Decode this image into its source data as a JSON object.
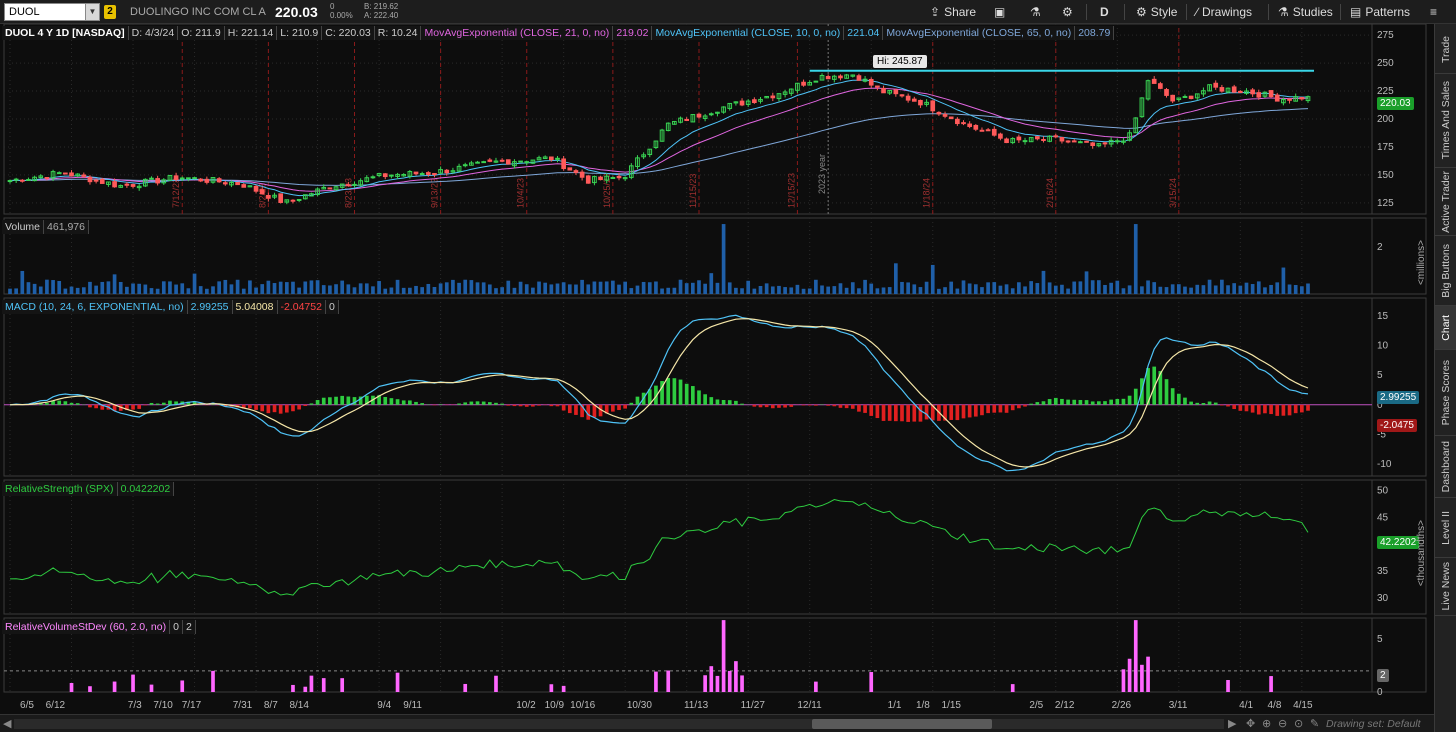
{
  "toolbar": {
    "symbol": "DUOL",
    "link_badge": "2",
    "company": "DUOLINGO INC COM CL A",
    "last": "220.03",
    "change": "0",
    "change_pct": "0.00%",
    "bid": "B: 219.62",
    "ask": "A: 222.40",
    "share": "Share",
    "timeframe": "D",
    "style": "Style",
    "drawings": "Drawings",
    "studies": "Studies",
    "patterns": "Patterns"
  },
  "price_pane": {
    "title": "DUOL 4 Y 1D [NASDAQ]",
    "ohlc": [
      "D: 4/3/24",
      "O: 211.9",
      "H: 221.14",
      "L: 210.9",
      "C: 220.03",
      "R: 10.24"
    ],
    "ma21_label": "MovAvgExponential (CLOSE, 21, 0, no)",
    "ma21_value": "219.02",
    "ma10_label": "MovAvgExponential (CLOSE, 10, 0, no)",
    "ma10_value": "221.04",
    "ma65_label": "MovAvgExponential (CLOSE, 65, 0, no)",
    "ma65_value": "208.79",
    "hi_label": "Hi: 245.87",
    "price_badge": "220.03",
    "ticks": [
      "275",
      "250",
      "225",
      "200",
      "175",
      "150",
      "125"
    ],
    "year_label": "2023 year",
    "event_dates": [
      "7/12/23",
      "8/2/23",
      "8/23/23",
      "9/13/23",
      "10/4/23",
      "10/25/23",
      "11/15/23",
      "12/15/23",
      "1/18/24",
      "2/16/24",
      "3/15/24"
    ]
  },
  "volume_pane": {
    "title": "Volume",
    "value": "461,976",
    "ticks": [
      "2"
    ],
    "units": "<millions>"
  },
  "macd_pane": {
    "title": "MACD (10, 24, 6, EXPONENTIAL, no)",
    "v1": "2.99255",
    "v2": "5.04008",
    "v3": "-2.04752",
    "v4": "0",
    "badge1": "2.99255",
    "badge2": "-2.0475",
    "ticks": [
      "15",
      "10",
      "5",
      "0",
      "-5",
      "-10"
    ]
  },
  "rs_pane": {
    "title": "RelativeStrength (SPX)",
    "value": "0.0422202",
    "badge": "42.2202",
    "ticks": [
      "50",
      "45",
      "40",
      "35",
      "30"
    ],
    "units": "<thousandths>"
  },
  "rv_pane": {
    "title": "RelativeVolumeStDev (60, 2.0, no)",
    "v1": "0",
    "v2": "2",
    "badge": "2",
    "ticks": [
      "5",
      "0"
    ]
  },
  "date_axis": [
    "6/5",
    "6/12",
    "7/3",
    "7/10",
    "7/17",
    "7/31",
    "8/7",
    "8/14",
    "9/4",
    "9/11",
    "10/2",
    "10/9",
    "10/16",
    "10/30",
    "11/13",
    "11/27",
    "12/11",
    "1/1",
    "1/8",
    "1/15",
    "2/5",
    "2/12",
    "2/26",
    "3/11",
    "4/1",
    "4/8",
    "4/15"
  ],
  "sidebar_tabs": [
    "Trade",
    "Times And Sales",
    "Active Trader",
    "Big Buttons",
    "Chart",
    "Phase Scores",
    "Dashboard",
    "Level II",
    "Live News"
  ],
  "bottom": {
    "drawing_set": "Drawing set: Default"
  },
  "colors": {
    "up": "#39d353",
    "down": "#ff5a5a",
    "ma10": "#4fc3f7",
    "ma21": "#e066e0",
    "ma65": "#7fa7d9",
    "hi_line": "#3ad6e8",
    "rs_line": "#2ecc40",
    "rv_bars": "#ff66ff",
    "macd_signal": "#f5e6a8"
  },
  "chart_data": {
    "type": "candlestick",
    "symbol": "DUOL",
    "x_range": [
      "6/1/23",
      "4/3/24"
    ],
    "price_close_key_points": [
      [
        0,
        145
      ],
      [
        12,
        152
      ],
      [
        25,
        140
      ],
      [
        38,
        148
      ],
      [
        52,
        142
      ],
      [
        62,
        125
      ],
      [
        72,
        140
      ],
      [
        85,
        150
      ],
      [
        95,
        152
      ],
      [
        110,
        162
      ],
      [
        122,
        165
      ],
      [
        130,
        145
      ],
      [
        138,
        148
      ],
      [
        148,
        195
      ],
      [
        160,
        210
      ],
      [
        172,
        222
      ],
      [
        182,
        238
      ],
      [
        190,
        240
      ],
      [
        196,
        225
      ],
      [
        205,
        215
      ],
      [
        215,
        195
      ],
      [
        225,
        180
      ],
      [
        235,
        182
      ],
      [
        245,
        175
      ],
      [
        252,
        185
      ],
      [
        256,
        235
      ],
      [
        262,
        215
      ],
      [
        270,
        228
      ],
      [
        278,
        225
      ],
      [
        286,
        218
      ],
      [
        292,
        220.03
      ]
    ],
    "hi": 245.87,
    "ylim": [
      115,
      285
    ]
  }
}
